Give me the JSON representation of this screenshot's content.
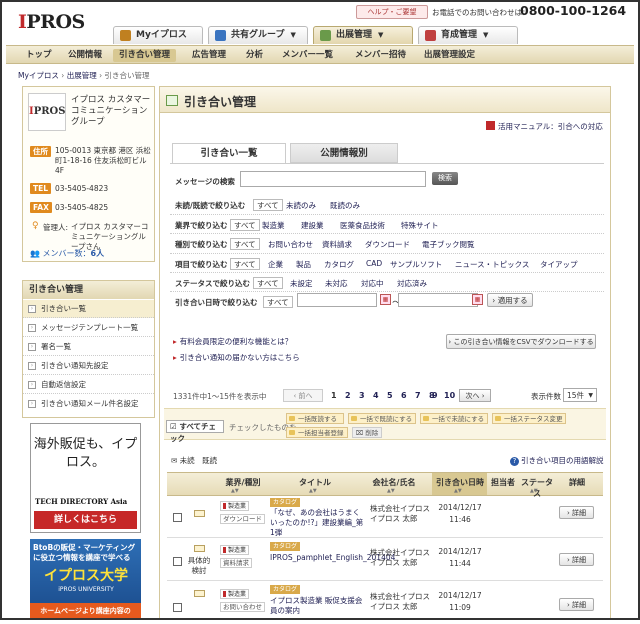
{
  "header": {
    "logo": "IPROS",
    "help_label": "ヘルプ・ご要望",
    "contact_text": "お電話でのお問い合わせは：",
    "phone": "0800-100-1264",
    "global_tabs": [
      {
        "label": "Myイプロス",
        "icon": "person-icon",
        "color": "#c08020"
      },
      {
        "label": "共有グループ",
        "icon": "group-icon",
        "color": "#3a74c0"
      },
      {
        "label": "出展管理",
        "icon": "list-icon",
        "color": "#6a9a4a"
      },
      {
        "label": "育成管理",
        "icon": "chart-icon",
        "color": "#c04040"
      }
    ]
  },
  "nav": [
    "トップ",
    "公開情報",
    "引き合い管理",
    "広告管理",
    "分析",
    "メンバー一覧",
    "メンバー招待",
    "出展管理設定"
  ],
  "breadcrumb": [
    "Myイプロス",
    "出展管理",
    "引き合い管理"
  ],
  "company": {
    "logo": "IPROS",
    "name": "イプロス カスタマーコミュニケーショングループ",
    "addr_label": "住所",
    "addr": "105-0013 東京都 港区 浜松町1-18-16 住友浜松町ビル4F",
    "tel_label": "TEL",
    "tel": "03-5405-4823",
    "fax_label": "FAX",
    "fax": "03-5405-4825",
    "mgr_label": "管理人:",
    "mgr": "イプロス カスタマーコミュニケーショングループさん",
    "member_label": "メンバー数：",
    "member_count": "6人"
  },
  "side_menu": {
    "title": "引き合い管理",
    "items": [
      "引き合い一覧",
      "メッセージテンプレート一覧",
      "署名一覧",
      "引き合い通知先設定",
      "自動返信設定",
      "引き合い通知メール件名設定"
    ]
  },
  "ads": {
    "ad1_text": "海外販促も、イプロス。",
    "ad1_brand": "TECH DIRECTORY Asia",
    "ad1_button": "詳しくはこちら",
    "ad2_text": "BtoBの販促・マーケティングに役立つ情報を講座で学べる",
    "ad2_title": "イプロス大学",
    "ad2_sub": "iPROS UNIVERSITY",
    "ad2_footer": "ホームページより講座内容の"
  },
  "main": {
    "title": "引き合い管理",
    "manual_link": "活用マニュアル：引合への対応",
    "tabs": [
      "引き合い一覧",
      "公開情報別"
    ],
    "search_label": "メッセージの検索",
    "search_button": "検索",
    "filters": [
      {
        "label": "未読/既読で絞り込む",
        "opts": [
          "すべて",
          "未読のみ",
          "既読のみ"
        ]
      },
      {
        "label": "業界で絞り込む",
        "opts": [
          "すべて",
          "製造業",
          "建設業",
          "医薬食品技術",
          "特殊サイト"
        ]
      },
      {
        "label": "種別で絞り込む",
        "opts": [
          "すべて",
          "お問い合わせ",
          "資料請求",
          "ダウンロード",
          "電子ブック閲覧"
        ]
      },
      {
        "label": "項目で絞り込む",
        "opts": [
          "すべて",
          "企業",
          "製品",
          "カタログ",
          "CAD",
          "サンプルソフト",
          "ニュース・トピックス",
          "タイアップ"
        ]
      },
      {
        "label": "ステータスで絞り込む",
        "opts": [
          "すべて",
          "未設定",
          "未対応",
          "対応中",
          "対応済み"
        ]
      }
    ],
    "date_label": "引き合い日時で絞り込む",
    "date_all": "すべて",
    "date_tilde": "〜",
    "apply_button": "適用する",
    "info_links": [
      "有料会員限定の便利な機能とは？",
      "引き合い通知の届かない方はこちら"
    ],
    "csv_button": "この引き合い情報をCSVでダウンロードする",
    "count_text": "1331件中1〜15件を表示中",
    "prev": "前へ",
    "pages": [
      "1",
      "2",
      "3",
      "4",
      "5",
      "6",
      "7",
      "8",
      "9",
      "10"
    ],
    "next": "次へ",
    "per_page_label": "表示件数",
    "per_page": "15件",
    "check_all": "すべてチェック",
    "check_hint": "チェックしたものを",
    "bulk_actions": [
      "一括既読する",
      "一括で既読にする",
      "一括で未読にする",
      "一括ステータス変更",
      "一括担当者登録"
    ],
    "delete": "削除",
    "legend": "未読　既読",
    "glossary": "引き合い項目の用語解説",
    "columns": [
      "業界/種別",
      "タイトル",
      "会社名/氏名",
      "引き合い日時",
      "担当者",
      "ステータス",
      "詳細"
    ],
    "rows": [
      {
        "kento": "",
        "industry": "製造業",
        "type": "ダウンロード",
        "cat": "カタログ",
        "title": "「なぜ、あの会社はうまくいったのか!?」建設業編_第1弾",
        "company": "株式会社イプロス",
        "person": "イプロス 太郎",
        "date": "2014/12/17",
        "time": "11:46",
        "detail": "詳細"
      },
      {
        "kento": "具体的検討",
        "industry": "製造業",
        "type": "資料請求",
        "cat": "カタログ",
        "title": "IPROS_pamphlet_English_201404",
        "company": "株式会社イプロス",
        "person": "イプロス 太郎",
        "date": "2014/12/17",
        "time": "11:44",
        "detail": "詳細"
      },
      {
        "kento": "",
        "industry": "製造業",
        "type": "お問い合わせ",
        "cat": "カタログ",
        "title": "イプロス製造業 販促支援会員の案内",
        "company": "株式会社イプロス",
        "person": "イプロス 太郎",
        "date": "2014/12/17",
        "time": "11:09",
        "detail": "詳細"
      }
    ]
  }
}
